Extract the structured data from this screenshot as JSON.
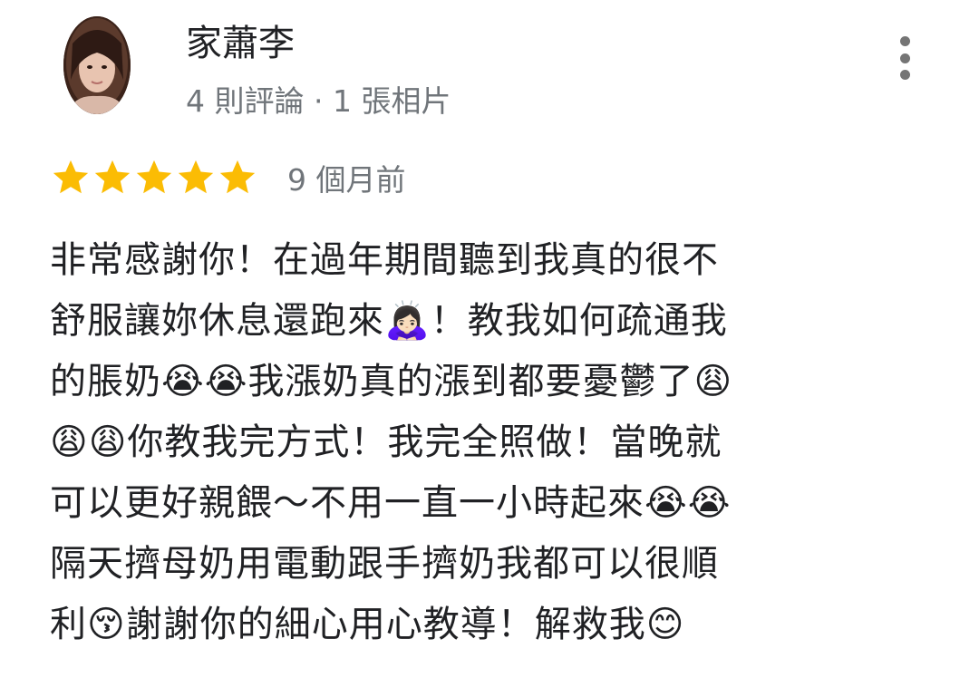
{
  "reviewer": {
    "name": "家蕭李",
    "meta": "4 則評論 · 1 張相片"
  },
  "rating": {
    "stars": 5,
    "max_stars": 5,
    "star_color": "#fbbc04",
    "time": "9 個月前"
  },
  "review_lines": [
    "非常感謝你！在過年期間聽到我真的很不",
    "舒服讓妳休息還跑來🙇🏻‍♀️！教我如何疏通我",
    "的脹奶😭😭我漲奶真的漲到都要憂鬱了😩",
    "😩😩你教我完方式！我完全照做！當晚就",
    "可以更好親餵～不用一直一小時起來😭😭",
    "隔天擠母奶用電動跟手擠奶我都可以很順",
    "利😚謝謝你的細心用心教導！解救我😊"
  ],
  "icons": {
    "more": "more-vert-icon",
    "star": "star-icon",
    "avatar": "reviewer-avatar"
  }
}
